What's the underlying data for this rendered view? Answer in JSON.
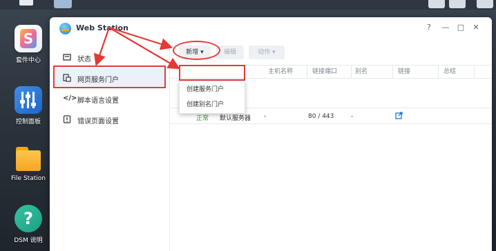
{
  "desktop": {
    "icons": [
      {
        "label": "套件中心"
      },
      {
        "label": "控制面板"
      },
      {
        "label": "File Station"
      },
      {
        "label": "DSM 说明"
      }
    ]
  },
  "window": {
    "title": "Web Station",
    "controls": {
      "help": "?",
      "minimize": "—",
      "maximize": "□",
      "close": "✕"
    }
  },
  "sidebar": {
    "items": [
      {
        "label": "状态",
        "icon": "status-icon"
      },
      {
        "label": "网页服务门户",
        "icon": "portal-icon"
      },
      {
        "label": "脚本语言设置",
        "icon": "code-icon"
      },
      {
        "label": "错误页面设置",
        "icon": "error-page-icon"
      }
    ]
  },
  "toolbar": {
    "create_label": "新增",
    "edit_label": "编辑",
    "action_label": "动作"
  },
  "table": {
    "columns": [
      "主机名称",
      "链接端口",
      "别名",
      "链接",
      "总结"
    ],
    "rows": [
      {
        "status": "正常",
        "service": "默认服务器",
        "host": "-",
        "port": "80 / 443",
        "alias": "-"
      }
    ]
  },
  "dropdown": {
    "items": [
      "创建服务门户",
      "创建别名门户"
    ]
  },
  "colors": {
    "annotation": "#e53935",
    "status_ok": "#2e9b3e",
    "link": "#1a7bd6"
  }
}
